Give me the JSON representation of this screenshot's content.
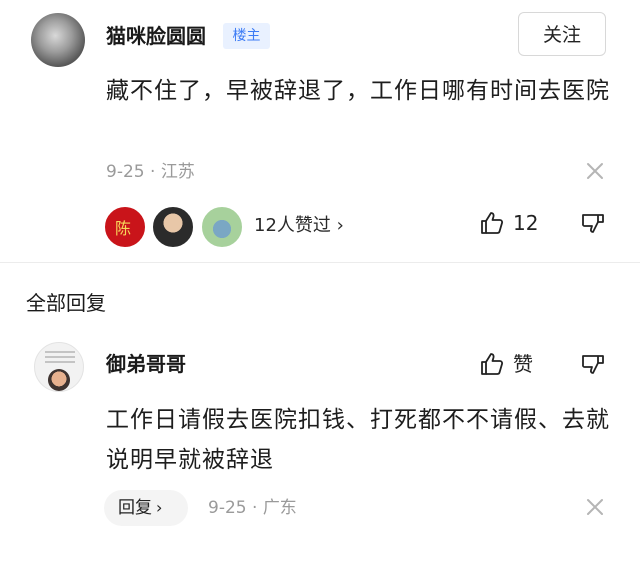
{
  "post": {
    "author": "猫咪脸圆圆",
    "badge": "楼主",
    "follow_label": "关注",
    "text": "藏不住了，早被辞退了，工作日哪有时间去医院",
    "date": "9-25",
    "meta_separator": "·",
    "location": "江苏",
    "liker_seal_text": "陈",
    "likes_summary": "12人赞过",
    "likes_summary_chevron": "›",
    "like_count": "12"
  },
  "replies": {
    "header": "全部回复",
    "items": [
      {
        "author": "御弟哥哥",
        "like_label": "赞",
        "text": "工作日请假去医院扣钱、打死都不不请假、去就说明早就被辞退",
        "reply_label": "回复",
        "reply_chevron": "›",
        "date": "9-25",
        "meta_separator": "·",
        "location": "广东"
      }
    ]
  },
  "icons": {
    "thumb_up": "thumbs-up-icon",
    "thumb_down": "thumbs-down-icon",
    "close": "close-icon",
    "chevron": "chevron-right-icon"
  },
  "colors": {
    "badge_bg": "#e9f1ff",
    "badge_text": "#3d7cf5",
    "meta_text": "#9a9a9a",
    "divider": "#ececec",
    "reply_button_bg": "#f4f4f4"
  }
}
